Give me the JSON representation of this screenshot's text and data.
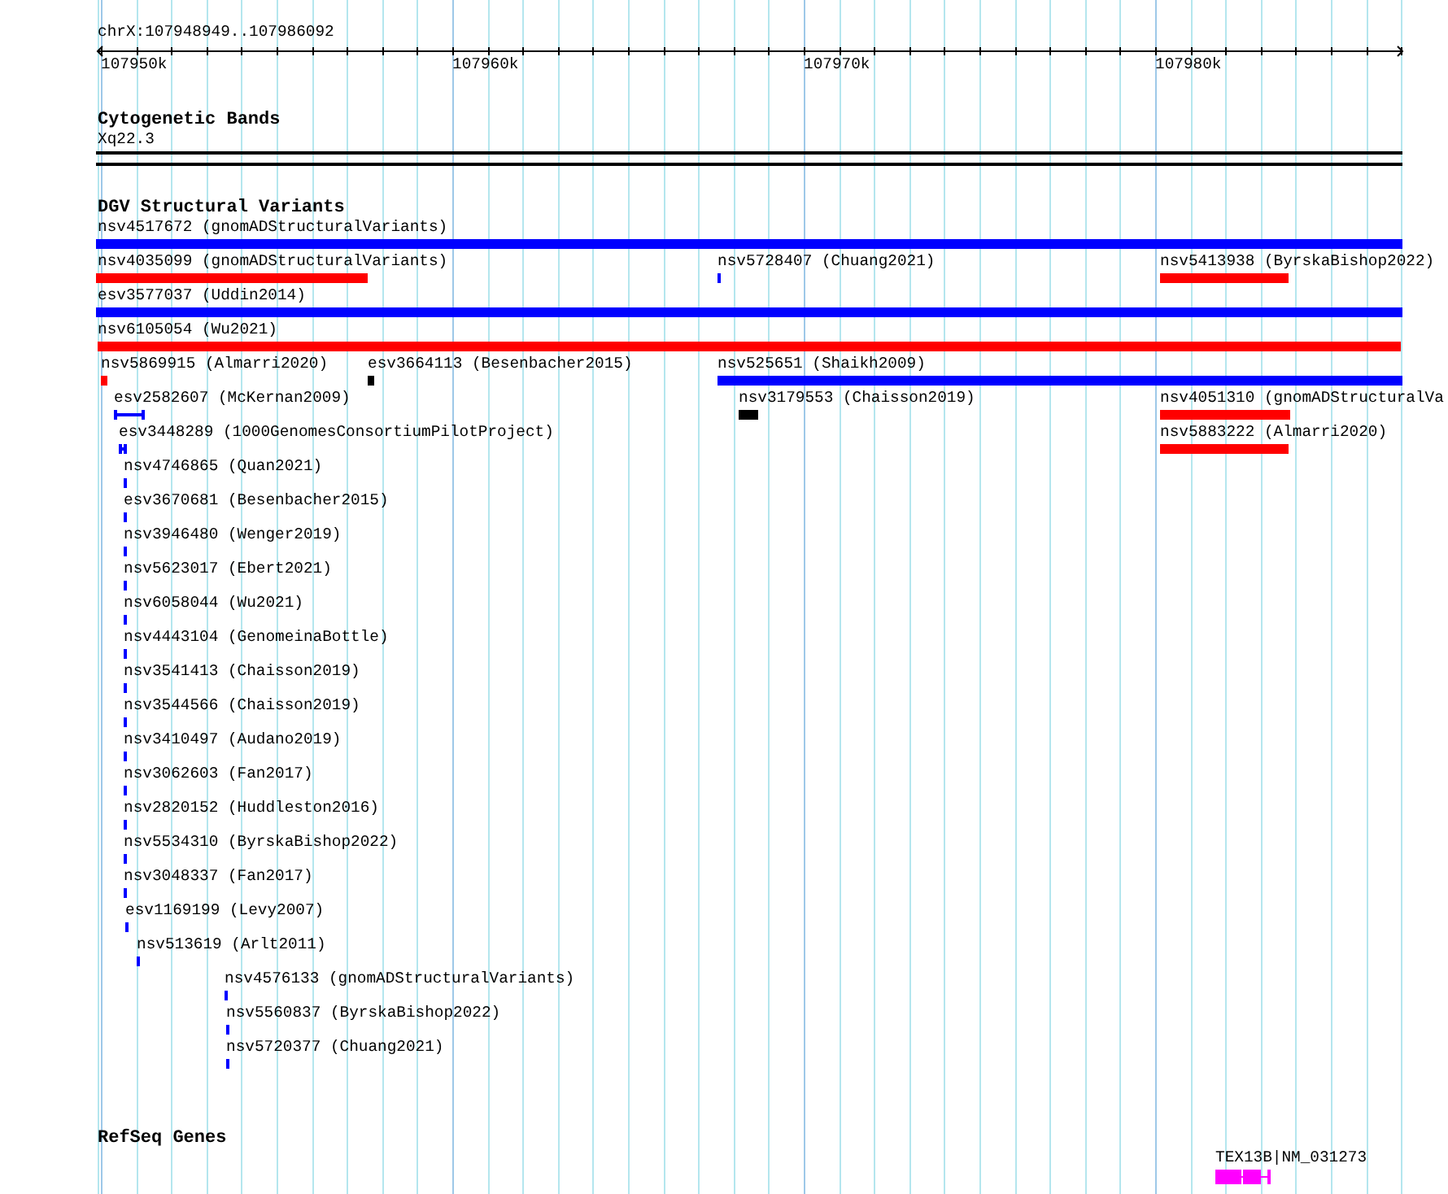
{
  "ruler": {
    "location": "chrX:107948949..107986092",
    "ticks": [
      "107950k",
      "107960k",
      "107970k",
      "107980k"
    ]
  },
  "tracks": [
    {
      "kind": "cytoband",
      "title": "Cytogenetic Bands",
      "band": "Xq22.3"
    },
    {
      "kind": "variants",
      "title": "DGV Structural Variants",
      "features": [
        {
          "label": "nsv4517672 (gnomADStructuralVariants)",
          "color": "#0000ff",
          "kind": "bar"
        },
        {
          "label": "nsv4035099 (gnomADStructuralVariants)",
          "color": "#ff0000",
          "kind": "bar"
        },
        {
          "label": "nsv5728407 (Chuang2021)",
          "color": "#0000ff",
          "kind": "bar"
        },
        {
          "label": "nsv5413938 (ByrskaBishop2022)",
          "color": "#ff0000",
          "kind": "bar"
        },
        {
          "label": "esv3577037 (Uddin2014)",
          "color": "#0000ff",
          "kind": "bar"
        },
        {
          "label": "nsv6105054 (Wu2021)",
          "color": "#ff0000",
          "kind": "bar"
        },
        {
          "label": "nsv5869915 (Almarri2020)",
          "color": "#ff0000",
          "kind": "bar"
        },
        {
          "label": "esv3664113 (Besenbacher2015)",
          "color": "#000000",
          "kind": "bar"
        },
        {
          "label": "nsv525651 (Shaikh2009)",
          "color": "#0000ff",
          "kind": "bar"
        },
        {
          "label": "esv2582607 (McKernan2009)",
          "color": "#0000ff",
          "kind": "interval"
        },
        {
          "label": "nsv3179553 (Chaisson2019)",
          "color": "#000000",
          "kind": "bar"
        },
        {
          "label": "nsv4051310 (gnomADStructuralVa",
          "color": "#ff0000",
          "kind": "bar"
        },
        {
          "label": "esv3448289 (1000GenomesConsortiumPilotProject)",
          "color": "#0000ff",
          "kind": "interval"
        },
        {
          "label": "nsv5883222 (Almarri2020)",
          "color": "#ff0000",
          "kind": "bar"
        },
        {
          "label": "nsv4746865 (Quan2021)",
          "color": "#0000ff",
          "kind": "bar"
        },
        {
          "label": "esv3670681 (Besenbacher2015)",
          "color": "#0000ff",
          "kind": "bar"
        },
        {
          "label": "nsv3946480 (Wenger2019)",
          "color": "#0000ff",
          "kind": "bar"
        },
        {
          "label": "nsv5623017 (Ebert2021)",
          "color": "#0000ff",
          "kind": "bar"
        },
        {
          "label": "nsv6058044 (Wu2021)",
          "color": "#0000ff",
          "kind": "bar"
        },
        {
          "label": "nsv4443104 (GenomeinaBottle)",
          "color": "#0000ff",
          "kind": "bar"
        },
        {
          "label": "nsv3541413 (Chaisson2019)",
          "color": "#0000ff",
          "kind": "bar"
        },
        {
          "label": "nsv3544566 (Chaisson2019)",
          "color": "#0000ff",
          "kind": "bar"
        },
        {
          "label": "nsv3410497 (Audano2019)",
          "color": "#0000ff",
          "kind": "bar"
        },
        {
          "label": "nsv3062603 (Fan2017)",
          "color": "#0000ff",
          "kind": "bar"
        },
        {
          "label": "nsv2820152 (Huddleston2016)",
          "color": "#0000ff",
          "kind": "bar"
        },
        {
          "label": "nsv5534310 (ByrskaBishop2022)",
          "color": "#0000ff",
          "kind": "bar"
        },
        {
          "label": "nsv3048337 (Fan2017)",
          "color": "#0000ff",
          "kind": "bar"
        },
        {
          "label": "esv1169199 (Levy2007)",
          "color": "#0000ff",
          "kind": "bar"
        },
        {
          "label": "nsv513619 (Arlt2011)",
          "color": "#0000ff",
          "kind": "bar"
        },
        {
          "label": "nsv4576133 (gnomADStructuralVariants)",
          "color": "#0000ff",
          "kind": "bar"
        },
        {
          "label": "nsv5560837 (ByrskaBishop2022)",
          "color": "#0000ff",
          "kind": "bar"
        },
        {
          "label": "nsv5720377 (Chuang2021)",
          "color": "#0000ff",
          "kind": "bar"
        }
      ]
    },
    {
      "kind": "genes",
      "title": "RefSeq Genes",
      "genes": [
        {
          "label": "TEX13B|NM_031273",
          "color": "#ff00ff"
        }
      ]
    }
  ]
}
